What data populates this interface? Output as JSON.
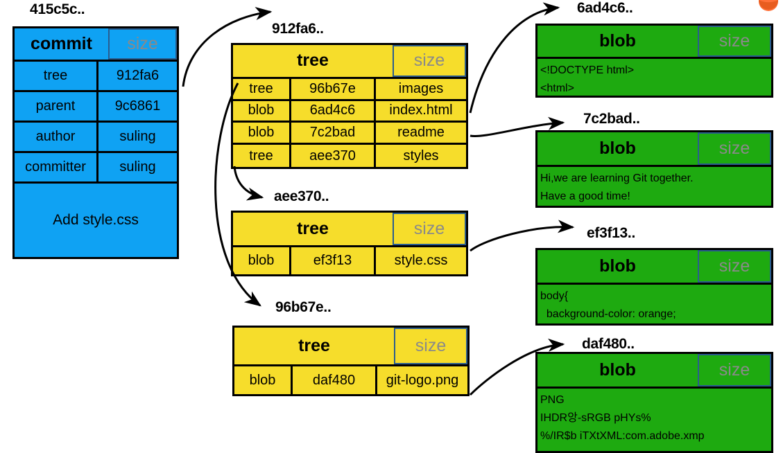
{
  "diagram": {
    "title": "git-object-model",
    "colors": {
      "commit": "#0fa2f3",
      "tree": "#f6dd2b",
      "blob": "#1eaa10",
      "size_border": "#2a5d8f",
      "size_text": "#8a8a8a",
      "outline": "#000000"
    },
    "size_label": "size"
  },
  "commit_node": {
    "title": "415c5c..",
    "type_label": "commit",
    "size_label": "size",
    "rows": [
      {
        "key": "tree",
        "value": "912fa6"
      },
      {
        "key": "parent",
        "value": "9c6861"
      },
      {
        "key": "author",
        "value": "suling"
      },
      {
        "key": "committer",
        "value": "suling"
      }
    ],
    "message": "Add style.css"
  },
  "tree_nodes": [
    {
      "title": "912fa6..",
      "type_label": "tree",
      "size_label": "size",
      "entries": [
        {
          "mode": "tree",
          "hash": "96b67e",
          "name": "images"
        },
        {
          "mode": "blob",
          "hash": "6ad4c6",
          "name": "index.html"
        },
        {
          "mode": "blob",
          "hash": "7c2bad",
          "name": "readme"
        },
        {
          "mode": "tree",
          "hash": "aee370",
          "name": "styles"
        }
      ]
    },
    {
      "title": "aee370..",
      "type_label": "tree",
      "size_label": "size",
      "entries": [
        {
          "mode": "blob",
          "hash": "ef3f13",
          "name": "style.css"
        }
      ]
    },
    {
      "title": "96b67e..",
      "type_label": "tree",
      "size_label": "size",
      "entries": [
        {
          "mode": "blob",
          "hash": "daf480",
          "name": "git-logo.png"
        }
      ]
    }
  ],
  "blob_nodes": [
    {
      "title": "6ad4c6..",
      "type_label": "blob",
      "size_label": "size",
      "lines": [
        "<!DOCTYPE html>",
        "<html>"
      ]
    },
    {
      "title": "7c2bad..",
      "type_label": "blob",
      "size_label": "size",
      "lines": [
        "Hi,we are learning Git together.",
        "Have a good time!"
      ]
    },
    {
      "title": "ef3f13..",
      "type_label": "blob",
      "size_label": "size",
      "lines": [
        "body{",
        "  background-color: orange;"
      ]
    },
    {
      "title": "daf480..",
      "type_label": "blob",
      "size_label": "size",
      "lines": [
        "PNG",
        "",
        "IHDR앙-sRGB pHYs%",
        "%/IR$b iTXtXML:com.adobe.xmp"
      ]
    }
  ]
}
